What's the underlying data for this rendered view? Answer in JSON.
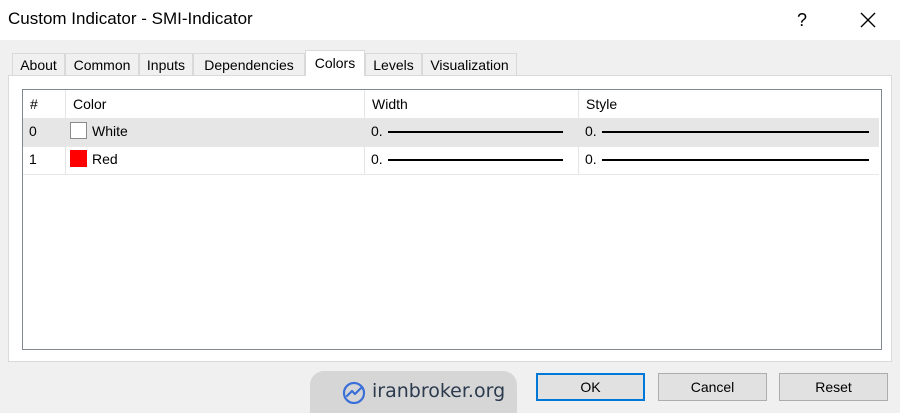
{
  "window": {
    "title": "Custom Indicator - SMI-Indicator",
    "help_label": "?"
  },
  "tabs": [
    {
      "label": "About"
    },
    {
      "label": "Common"
    },
    {
      "label": "Inputs"
    },
    {
      "label": "Dependencies"
    },
    {
      "label": "Colors",
      "active": true
    },
    {
      "label": "Levels"
    },
    {
      "label": "Visualization"
    }
  ],
  "table": {
    "headers": [
      "#",
      "Color",
      "Width",
      "Style"
    ],
    "rows": [
      {
        "index": "0",
        "color_name": "White",
        "color_hex": "#ffffff",
        "width": "0.",
        "style": "0.",
        "selected": true
      },
      {
        "index": "1",
        "color_name": "Red",
        "color_hex": "#ff0000",
        "width": "0.",
        "style": "0.",
        "selected": false
      }
    ]
  },
  "watermark": {
    "text": "iranbroker.org"
  },
  "buttons": {
    "ok": "OK",
    "cancel": "Cancel",
    "reset": "Reset"
  },
  "colors": {
    "accent": "#0078d7",
    "selected_row": "#e6e6e6",
    "dialog_bg": "#f0f0f0"
  }
}
